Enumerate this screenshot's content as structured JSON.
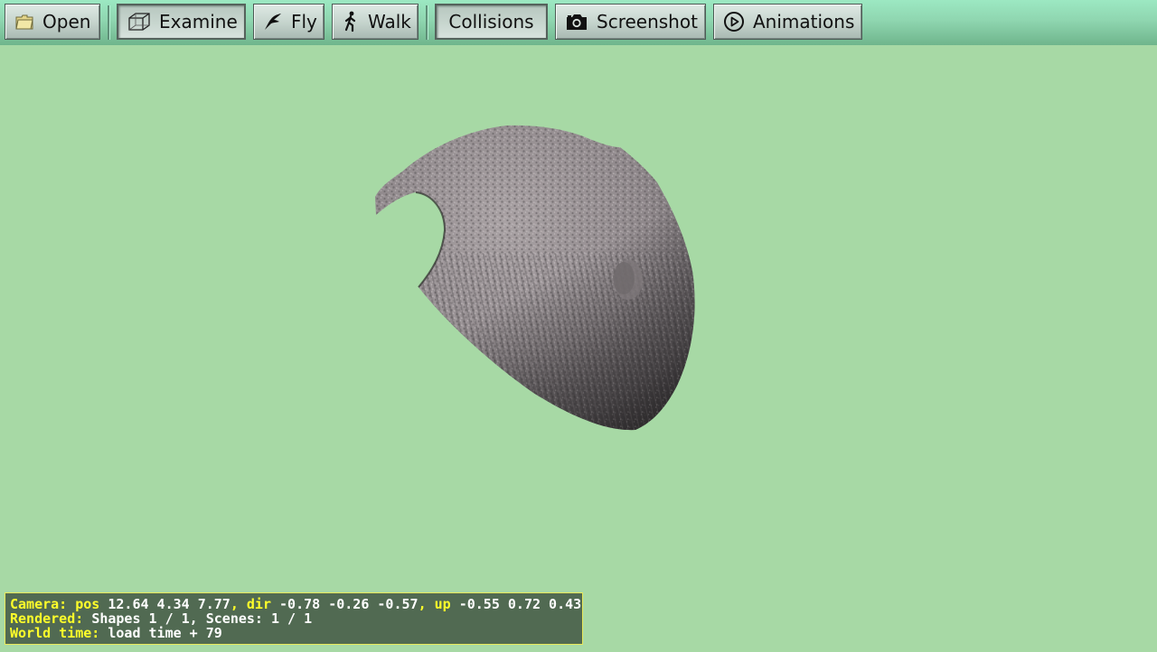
{
  "toolbar": {
    "buttons": [
      {
        "label": "Open",
        "icon": "folder-icon"
      },
      {
        "label": "Examine",
        "icon": "cube-icon"
      },
      {
        "label": "Fly",
        "icon": "bird-icon"
      },
      {
        "label": "Walk",
        "icon": "walking-person-icon"
      },
      {
        "label": "Collisions"
      },
      {
        "label": "Screenshot",
        "icon": "camera-icon"
      },
      {
        "label": "Animations",
        "icon": "play-circle-icon"
      }
    ]
  },
  "status": {
    "line1": {
      "camera_key": "Camera:",
      "pos_key": "pos",
      "pos_val": "12.64 4.34 7.77",
      "dir_key": ", dir",
      "dir_val": "-0.78 -0.26 -0.57",
      "up_key": ", up",
      "up_val": "-0.55 0.72 0.43"
    },
    "line2": {
      "rendered_key": "Rendered:",
      "rendered_val": "Shapes 1 / 1, Scenes: 1 / 1"
    },
    "line3": {
      "world_key": "World time:",
      "world_val": "load time + 79"
    }
  },
  "colors": {
    "background": "#a7d9a5",
    "status_key": "#ffff2a",
    "status_bg": "#516a52"
  }
}
